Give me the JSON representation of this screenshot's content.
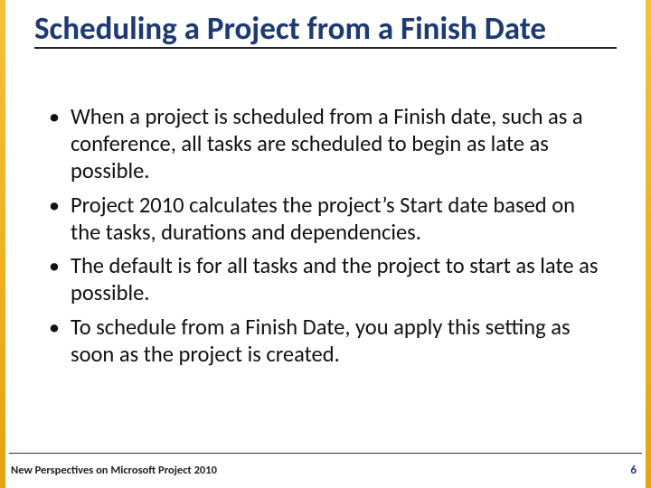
{
  "title": "Scheduling a Project from a Finish Date",
  "bullets": [
    "When a project is scheduled from a Finish date, such as a conference, all tasks are scheduled to begin as late as possible.",
    "Project 2010 calculates the project’s Start date based on the tasks, durations and dependencies.",
    "The default is for all tasks and the project to start as late as possible.",
    "To schedule from a Finish Date, you apply this setting as soon as the project is created."
  ],
  "footer": {
    "left": "New Perspectives on Microsoft Project 2010",
    "page": "6"
  }
}
